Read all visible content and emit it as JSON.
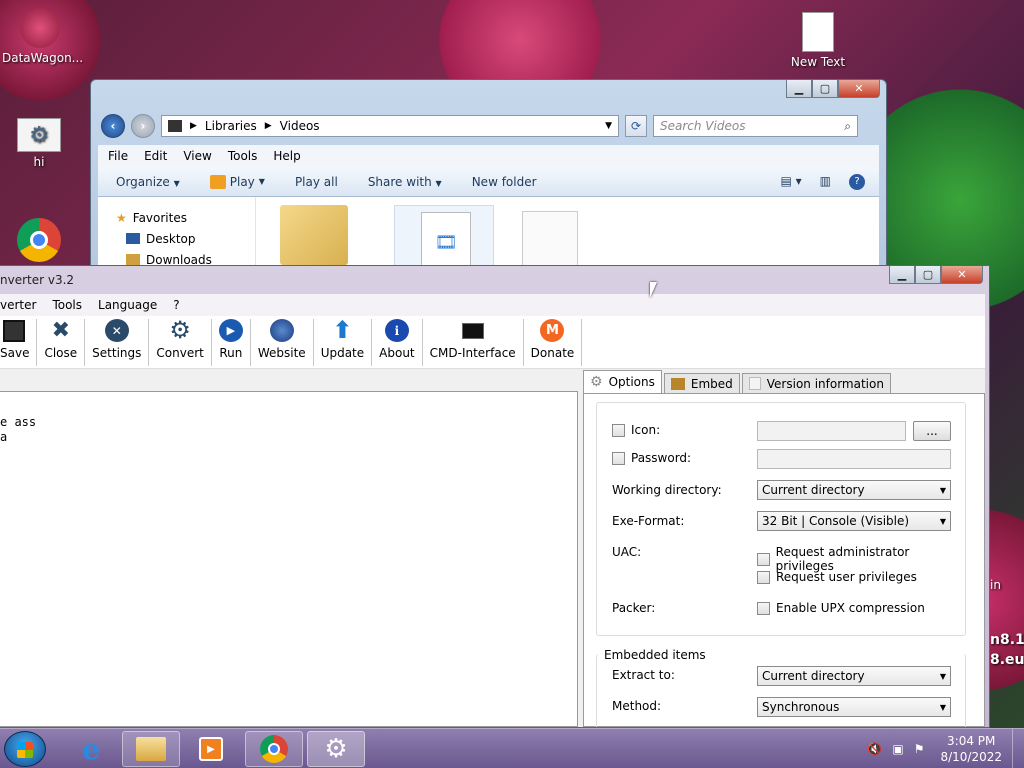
{
  "desktop": {
    "icons": [
      {
        "label": "DataWagon..."
      },
      {
        "label": "hi"
      },
      {
        "label": "New Text"
      }
    ],
    "bg_text": [
      "in",
      "n8.1",
      "8.eu"
    ]
  },
  "explorer": {
    "breadcrumb": [
      "Libraries",
      "Videos"
    ],
    "search_placeholder": "Search Videos",
    "menu": [
      "File",
      "Edit",
      "View",
      "Tools",
      "Help"
    ],
    "commands": {
      "organize": "Organize",
      "play": "Play",
      "play_all": "Play all",
      "share_with": "Share with",
      "new_folder": "New folder"
    },
    "nav": [
      "Favorites",
      "Desktop",
      "Downloads"
    ]
  },
  "converter": {
    "title": "nverter v3.2",
    "menu": [
      "verter",
      "Tools",
      "Language",
      "?"
    ],
    "toolbar": [
      "Save",
      "Close",
      "Settings",
      "Convert",
      "Run",
      "Website",
      "Update",
      "About",
      "CMD-Interface",
      "Donate"
    ],
    "editor_lines": [
      "e ass",
      "a"
    ],
    "tabs": [
      "Options",
      "Embed",
      "Version information"
    ],
    "options": {
      "icon_label": "Icon:",
      "browse_label": "...",
      "password_label": "Password:",
      "workdir_label": "Working directory:",
      "workdir_value": "Current directory",
      "exe_label": "Exe-Format:",
      "exe_value": "32 Bit | Console (Visible)",
      "uac_label": "UAC:",
      "uac_admin": "Request administrator privileges",
      "uac_user": "Request user privileges",
      "packer_label": "Packer:",
      "upx": "Enable UPX compression"
    },
    "embedded": {
      "group_title": "Embedded items",
      "extract_label": "Extract to:",
      "extract_value": "Current directory",
      "method_label": "Method:",
      "method_value": "Synchronous"
    }
  },
  "taskbar": {
    "time": "3:04 PM",
    "date": "8/10/2022"
  }
}
